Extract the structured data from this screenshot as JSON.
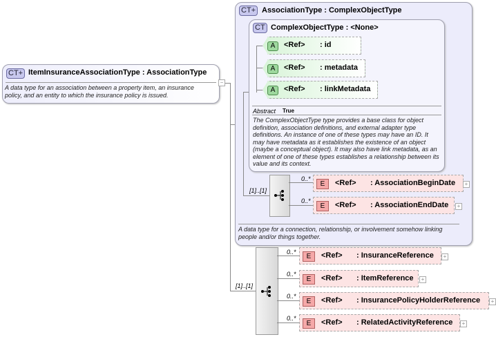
{
  "root": {
    "badge": "CT+",
    "title": "ItemInsuranceAssociationType : AssociationType",
    "description": "A data type for an association between a property item, an insurance policy, and an entity to which the insurance policy is issued.",
    "collapse": "−"
  },
  "association": {
    "badge": "CT+",
    "title": "AssociationType : ComplexObjectType",
    "description": "A data type for a connection, relationship, or involvement somehow linking people and/or things together.",
    "complex": {
      "badge": "CT",
      "title": "ComplexObjectType : <None>",
      "abstract_label": "Abstract",
      "abstract_value": "True",
      "description": "The ComplexObjectType type provides a base class for object definition, association definitions, and external adapter type definitions. An instance of one of these types may have an ID. It may have metadata as it establishes the existence of an object (maybe a conceptual object). It may also have link metadata, as an element of one of these types establishes a relationship between its value and its context.",
      "attributes": [
        {
          "badge": "A",
          "ref": "<Ref>",
          "name": ": id"
        },
        {
          "badge": "A",
          "ref": "<Ref>",
          "name": ": metadata"
        },
        {
          "badge": "A",
          "ref": "<Ref>",
          "name": ": linkMetadata"
        }
      ]
    },
    "sequence_card": "[1]..[1]",
    "elements": [
      {
        "card": "0..*",
        "badge": "E",
        "ref": "<Ref>",
        "name": ": AssociationBeginDate",
        "expand": "+"
      },
      {
        "card": "0..*",
        "badge": "E",
        "ref": "<Ref>",
        "name": ": AssociationEndDate",
        "expand": "+"
      }
    ]
  },
  "sequence": {
    "card": "[1]..[1]",
    "elements": [
      {
        "card": "0..*",
        "badge": "E",
        "ref": "<Ref>",
        "name": ": InsuranceReference",
        "expand": "+"
      },
      {
        "card": "0..*",
        "badge": "E",
        "ref": "<Ref>",
        "name": ": ItemReference",
        "expand": "+"
      },
      {
        "card": "0..*",
        "badge": "E",
        "ref": "<Ref>",
        "name": ": InsurancePolicyHolderReference",
        "expand": "+"
      },
      {
        "card": "0..*",
        "badge": "E",
        "ref": "<Ref>",
        "name": ": RelatedActivityReference",
        "expand": "+"
      }
    ]
  }
}
